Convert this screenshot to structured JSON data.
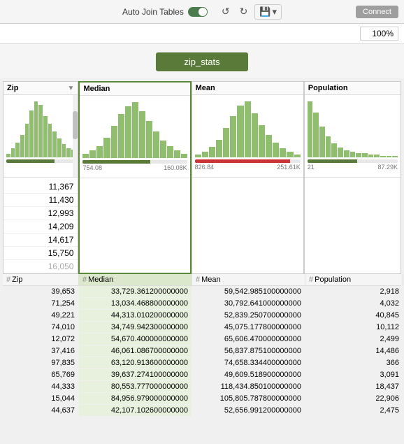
{
  "toolbar": {
    "auto_join_label": "Auto Join Tables",
    "run_label": "Connect",
    "zoom_value": "100%"
  },
  "table": {
    "name": "zip_stats"
  },
  "columns": [
    {
      "id": "zip",
      "label": "Zip",
      "type": "string",
      "active": false,
      "has_filter": true,
      "hist_bars": [
        2,
        5,
        8,
        12,
        18,
        25,
        30,
        28,
        22,
        18,
        14,
        10,
        7,
        5,
        4
      ],
      "prog_pct": 70,
      "prog_type": "normal",
      "range_min": "",
      "range_max": ""
    },
    {
      "id": "median",
      "label": "Median",
      "type": "number",
      "active": true,
      "has_filter": false,
      "hist_bars": [
        3,
        5,
        8,
        14,
        22,
        30,
        35,
        38,
        32,
        25,
        18,
        12,
        8,
        5,
        3
      ],
      "prog_pct": 65,
      "prog_type": "normal",
      "range_min": "754.08",
      "range_max": "160.08K"
    },
    {
      "id": "mean",
      "label": "Mean",
      "type": "number",
      "active": false,
      "has_filter": false,
      "hist_bars": [
        2,
        4,
        7,
        12,
        20,
        28,
        35,
        38,
        30,
        22,
        15,
        10,
        6,
        4,
        2
      ],
      "prog_pct": 90,
      "prog_type": "danger",
      "range_min": "826.84",
      "range_max": "251.61K"
    },
    {
      "id": "population",
      "label": "Population",
      "type": "number",
      "active": false,
      "has_filter": false,
      "hist_bars": [
        40,
        32,
        22,
        15,
        10,
        7,
        5,
        4,
        3,
        3,
        2,
        2,
        1,
        1,
        1
      ],
      "prog_pct": 55,
      "prog_type": "normal",
      "range_min": "21",
      "range_max": "87.29K"
    }
  ],
  "zip_list": [
    "11,367",
    "11,430",
    "12,993",
    "14,209",
    "14,617",
    "15,750",
    "16,050"
  ],
  "rows": [
    {
      "zip": "39,653",
      "median": "33,729.361200000000",
      "mean": "59,542.985100000000",
      "population": "2,918"
    },
    {
      "zip": "71,254",
      "median": "13,034.468800000000",
      "mean": "30,792.641000000000",
      "population": "4,032"
    },
    {
      "zip": "49,221",
      "median": "44,313.010200000000",
      "mean": "52,839.250700000000",
      "population": "40,845"
    },
    {
      "zip": "74,010",
      "median": "34,749.942300000000",
      "mean": "45,075.177800000000",
      "population": "10,112"
    },
    {
      "zip": "12,072",
      "median": "54,670.400000000000",
      "mean": "65,606.470000000000",
      "population": "2,499"
    },
    {
      "zip": "37,416",
      "median": "46,061.086700000000",
      "mean": "56,837.875100000000",
      "population": "14,486"
    },
    {
      "zip": "97,835",
      "median": "63,120.913600000000",
      "mean": "74,658.334400000000",
      "population": "366"
    },
    {
      "zip": "65,769",
      "median": "39,637.274100000000",
      "mean": "49,609.518900000000",
      "population": "3,091"
    },
    {
      "zip": "44,333",
      "median": "80,553.777000000000",
      "mean": "118,434.850100000000",
      "population": "18,437"
    },
    {
      "zip": "15,044",
      "median": "84,956.979000000000",
      "mean": "105,805.787800000000",
      "population": "22,906"
    },
    {
      "zip": "44,637",
      "median": "42,107.102600000000",
      "mean": "52,656.991200000000",
      "population": "2,475"
    }
  ]
}
